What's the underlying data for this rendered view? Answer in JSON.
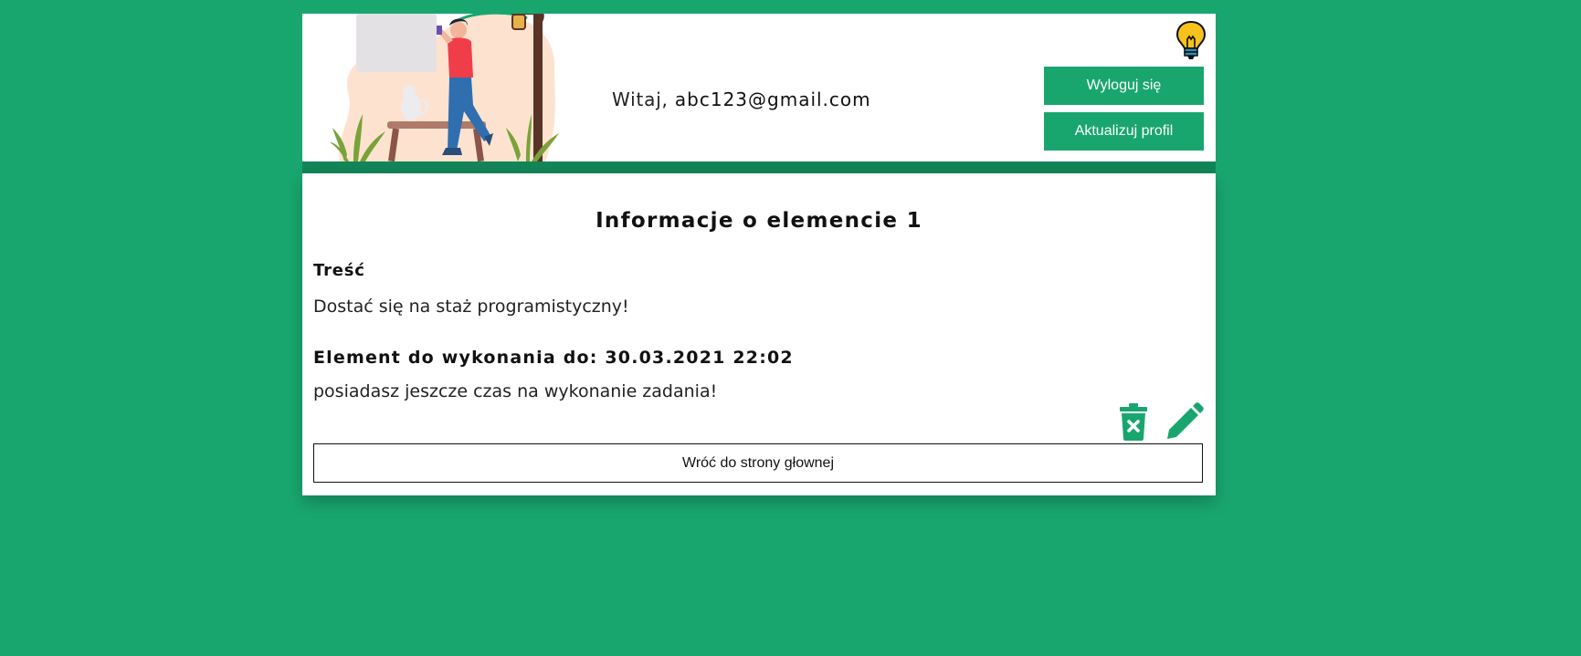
{
  "header": {
    "greeting_prefix": "Witaj,",
    "user_email": "abc123@gmail.com",
    "logout_label": "Wyloguj się",
    "update_profile_label": "Aktualizuj profil",
    "theme_toggle_icon": "lightbulb-icon"
  },
  "item": {
    "title": "Informacje o elemencie 1",
    "content_label": "Treść",
    "content_text": "Dostać się na staż programistyczny!",
    "deadline_text": "Element do wykonania do: 30.03.2021 22:02",
    "status_text": "posiadasz jeszcze czas na wykonanie zadania!",
    "delete_icon": "trash-icon",
    "edit_icon": "pencil-icon"
  },
  "navigation": {
    "back_label": "Wróć do strony głownej"
  },
  "colors": {
    "background": "#19a66e",
    "accent": "#19a66e",
    "header_strip": "#138558",
    "card": "#ffffff"
  }
}
